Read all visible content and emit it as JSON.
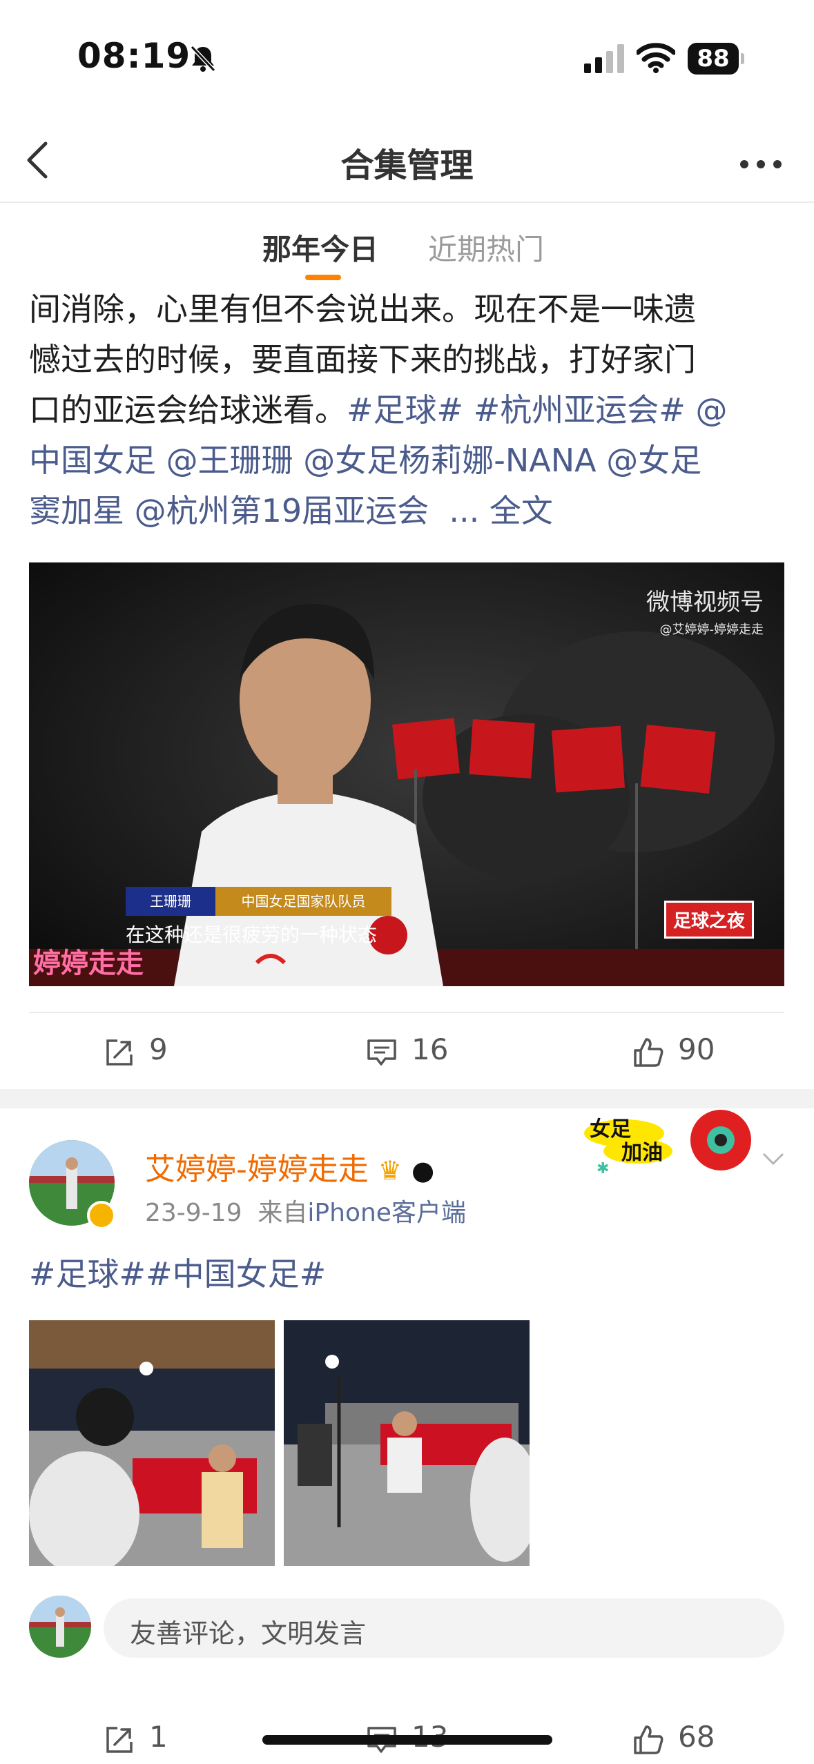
{
  "status_bar": {
    "time": "08:19",
    "battery": "88"
  },
  "nav": {
    "title": "合集管理"
  },
  "tabs": [
    {
      "label": "那年今日"
    },
    {
      "label": "近期热门"
    }
  ],
  "post1": {
    "text_lines": [
      "间消除，心里有但不会说出来。现在不是一味遗",
      "憾过去的时候，要直面接下来的挑战，打好家门",
      "口的亚运会给球迷看。"
    ],
    "hashtags": [
      "#足球#",
      "#杭州亚运会#"
    ],
    "mention_at": "@",
    "mentions_line4": [
      "中国女足",
      "@王珊珊",
      "@女足杨莉娜-NANA",
      "@女足"
    ],
    "mentions_line5": [
      "窦加星",
      "@杭州第19届亚运会"
    ],
    "more": "... 全文",
    "video": {
      "watermark": "微博视频号",
      "watermark_sub": "@艾婷婷-婷婷走走",
      "caption_name": "王珊珊",
      "caption_role": "中国女足国家队队员",
      "subtitle": "在这种还是很疲劳的一种状态",
      "logo_left": "婷婷走走",
      "logo_right": "足球之夜"
    },
    "actions": {
      "repost": "9",
      "comment": "16",
      "like": "90"
    }
  },
  "post2": {
    "author": "艾婷婷-婷婷走走",
    "date": "23-9-19",
    "source_prefix": "来自",
    "source": "iPhone客户端",
    "badge_line1": "女足",
    "badge_line2": "加油",
    "text": "#足球##中国女足#",
    "comment_placeholder": "友善评论，文明发言",
    "actions": {
      "repost": "1",
      "comment": "13",
      "like": "68"
    }
  },
  "colors": {
    "accent": "#ff8200",
    "link": "#4a5b8c",
    "author": "#f06a00"
  },
  "icons": [
    "bell-off-icon",
    "signal-icon",
    "wifi-icon",
    "battery-icon",
    "back-arrow-icon",
    "more-icon",
    "repost-icon",
    "comment-icon",
    "like-icon",
    "verified-icon",
    "chevron-down-icon"
  ]
}
